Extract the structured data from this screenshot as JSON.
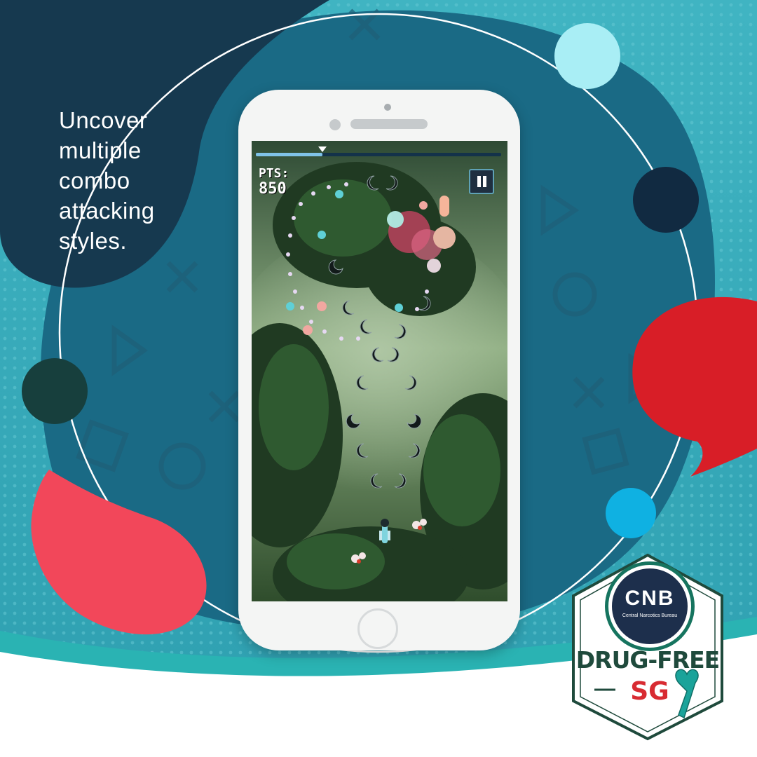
{
  "tagline": {
    "lines": [
      "Uncover",
      "multiple",
      "combo",
      "attacking",
      "styles."
    ]
  },
  "game": {
    "pts_label": "PTS:",
    "pts_value": "850",
    "level_progress": 0.27
  },
  "logo": {
    "cnb": "CNB",
    "cnb_full": "Central Narcotics Bureau",
    "drug_free": "DRUG-FREE",
    "sg": "SG"
  },
  "colors": {
    "teal_bg": "#3fb1bf",
    "navy_blob": "#17405a",
    "ring": "#ffffff",
    "red_accent": "#d81e27",
    "coral_accent": "#f2475a",
    "logo_green": "#1f4a3c",
    "logo_red": "#d82b32"
  }
}
